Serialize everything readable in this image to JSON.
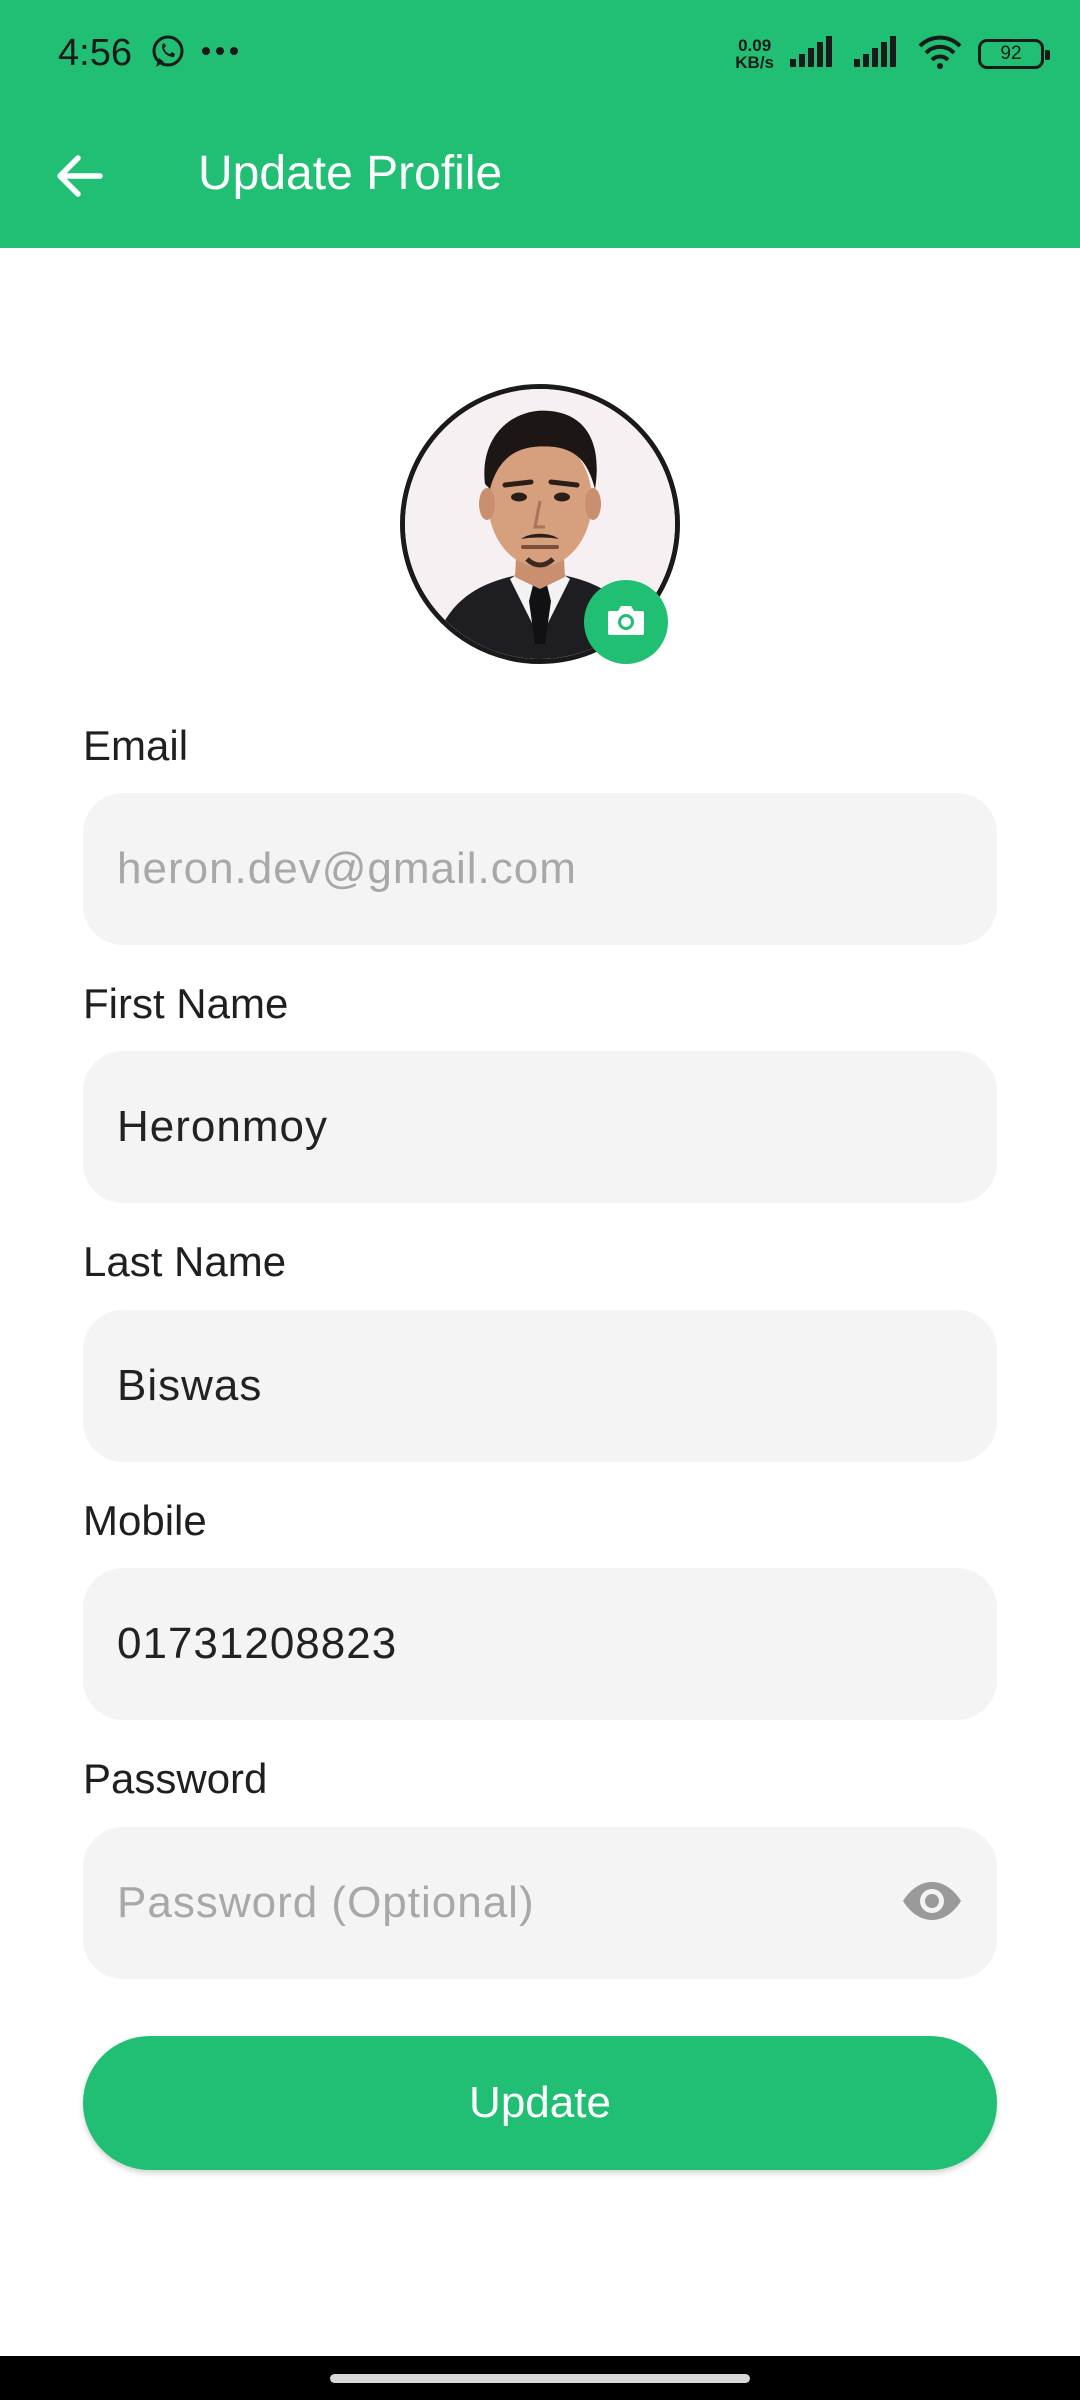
{
  "status_bar": {
    "time": "4:56",
    "net_speed_value": "0.09",
    "net_speed_unit": "KB/s",
    "battery": "92",
    "icons": [
      "whatsapp-icon",
      "more-icon",
      "signal-icon",
      "signal-icon",
      "wifi-icon",
      "battery-icon"
    ]
  },
  "app_bar": {
    "title": "Update Profile",
    "back_icon": "arrow-left-icon",
    "background": "#21bf73"
  },
  "avatar": {
    "camera_icon": "camera-icon"
  },
  "form": {
    "email": {
      "label": "Email",
      "value": "heron.dev@gmail.com",
      "disabled": true
    },
    "first_name": {
      "label": "First Name",
      "value": "Heronmoy"
    },
    "last_name": {
      "label": "Last Name",
      "value": "Biswas"
    },
    "mobile": {
      "label": "Mobile",
      "value": "01731208823"
    },
    "password": {
      "label": "Password",
      "placeholder": "Password (Optional)",
      "value": "",
      "toggle_icon": "eye-icon"
    }
  },
  "update_button": {
    "label": "Update"
  },
  "colors": {
    "accent": "#21bf73",
    "field_bg": "#f4f4f4",
    "placeholder": "#a8a8a8"
  }
}
